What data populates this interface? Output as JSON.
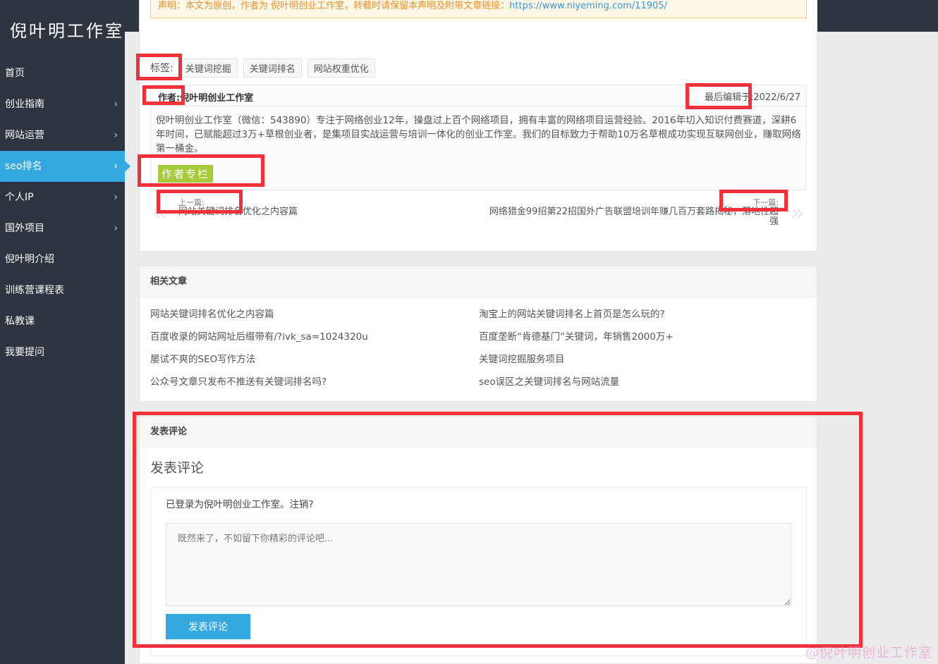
{
  "site": {
    "logo": "倪叶明工作室"
  },
  "sidebar": {
    "items": [
      {
        "label": "首页",
        "has_submenu": false,
        "active": false
      },
      {
        "label": "创业指南",
        "has_submenu": true,
        "active": false
      },
      {
        "label": "网站运营",
        "has_submenu": true,
        "active": false
      },
      {
        "label": "seo排名",
        "has_submenu": true,
        "active": true
      },
      {
        "label": "个人IP",
        "has_submenu": true,
        "active": false
      },
      {
        "label": "国外项目",
        "has_submenu": true,
        "active": false
      },
      {
        "label": "倪叶明介绍",
        "has_submenu": false,
        "active": false
      },
      {
        "label": "训练营课程表",
        "has_submenu": false,
        "active": false
      },
      {
        "label": "私教课",
        "has_submenu": false,
        "active": false
      },
      {
        "label": "我要提问",
        "has_submenu": false,
        "active": false
      }
    ],
    "chevron": "›"
  },
  "notice": {
    "text": "声明：本文为原创，作者为 倪叶明创业工作室，转载时请保留本声明及附带文章链接：",
    "link": "https://www.niyeming.com/11905/"
  },
  "tags": {
    "label": "标签:",
    "items": [
      "关键词挖掘",
      "关键词排名",
      "网站权重优化"
    ]
  },
  "author": {
    "label": "作者:",
    "name": "倪叶明创业工作室",
    "edited_label": "最后编辑于:",
    "edited_date": "2022/6/27",
    "description": "倪叶明创业工作室（微信：543890）专注于网络创业12年，操盘过上百个网络项目，拥有丰富的网络项目运营经验。2016年切入知识付费赛道，深耕6年时间，已赋能超过3万+草根创业者，是集项目实战运营与培训一体化的创业工作室。我们的目标致力于帮助10万名草根成功实现互联网创业，赚取网络第一桶金。",
    "column_button": "作者专栏"
  },
  "post_nav": {
    "prev_label": "上一篇:",
    "prev_title": "网站关键词排名优化之内容篇",
    "next_label": "下一篇:",
    "next_title": "网络猎金99招第22招国外广告联盟培训年赚几百万套路揭秘，落地性超强",
    "prev_arrow": "«",
    "next_arrow": "»"
  },
  "related": {
    "title": "相关文章",
    "items": [
      "网站关键词排名优化之内容篇",
      "淘宝上的网站关键词排名上首页是怎么玩的?",
      "百度收录的网站网址后缀带有/?ivk_sa=1024320u",
      "百度垄断“肯德基门”关键词，年销售2000万+",
      "屡试不爽的SEO写作方法",
      "关键词挖掘服务项目",
      "公众号文章只发布不推送有关键词排名吗?",
      "seo误区之关键词排名与网站流量"
    ]
  },
  "comment": {
    "section_title": "发表评论",
    "form_title": "发表评论",
    "logged_in_prefix": "已登录为倪叶明创业工作室。",
    "logout": "注销?",
    "placeholder": "既然来了，不如留下你精彩的评论吧...",
    "submit": "发表评论"
  },
  "watermark": "@倪叶明创业工作室",
  "colors": {
    "sidebar_bg": "#2e3440",
    "accent": "#35a8e0",
    "author_column_button": "#a5cb3a",
    "annotation_red": "#f2303a",
    "notice_text": "#e8902e"
  }
}
